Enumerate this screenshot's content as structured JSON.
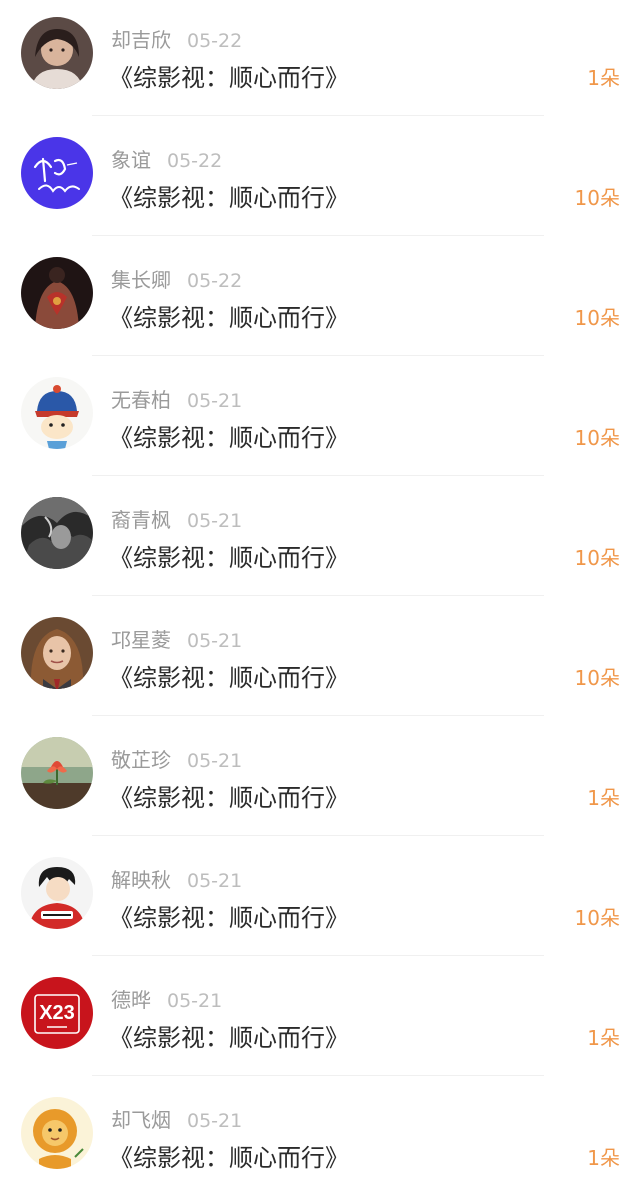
{
  "rows": [
    {
      "name": "却吉欣",
      "date": "05-22",
      "title": "《综影视：顺心而行》",
      "amount": "1朵",
      "avatar": "portrait-icon"
    },
    {
      "name": "象谊",
      "date": "05-22",
      "title": "《综影视：顺心而行》",
      "amount": "10朵",
      "avatar": "handwriting-icon"
    },
    {
      "name": "集长卿",
      "date": "05-22",
      "title": "《综影视：顺心而行》",
      "amount": "10朵",
      "avatar": "tattoo-back-icon"
    },
    {
      "name": "无春柏",
      "date": "05-21",
      "title": "《综影视：顺心而行》",
      "amount": "10朵",
      "avatar": "cartoon-official-icon"
    },
    {
      "name": "裔青枫",
      "date": "05-21",
      "title": "《综影视：顺心而行》",
      "amount": "10朵",
      "avatar": "smoke-portrait-icon"
    },
    {
      "name": "邛星菱",
      "date": "05-21",
      "title": "《综影视：顺心而行》",
      "amount": "10朵",
      "avatar": "girl-portrait-icon"
    },
    {
      "name": "敬芷珍",
      "date": "05-21",
      "title": "《综影视：顺心而行》",
      "amount": "1朵",
      "avatar": "flower-icon"
    },
    {
      "name": "解映秋",
      "date": "05-21",
      "title": "《综影视：顺心而行》",
      "amount": "10朵",
      "avatar": "anime-boy-icon"
    },
    {
      "name": "德晔",
      "date": "05-21",
      "title": "《综影视：顺心而行》",
      "amount": "1朵",
      "avatar": "x23-badge-icon"
    },
    {
      "name": "却飞烟",
      "date": "05-21",
      "title": "《综影视：顺心而行》",
      "amount": "1朵",
      "avatar": "lion-cartoon-icon"
    }
  ],
  "avatar_texts": {
    "x23": "X23"
  },
  "colors": {
    "name": "#9a9a9a",
    "date": "#bdbdbd",
    "title": "#2b2b2b",
    "amount": "#f0974a",
    "divider": "#f0f0f0"
  }
}
